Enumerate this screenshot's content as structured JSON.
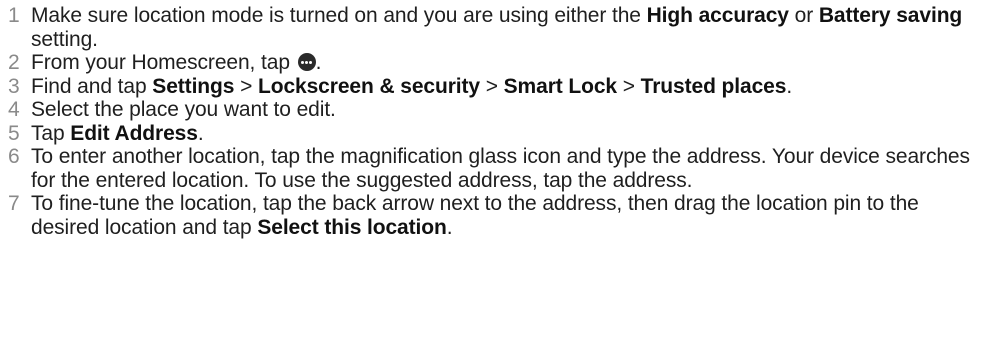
{
  "steps": [
    {
      "number": "1",
      "parts": [
        {
          "text": "Make sure location mode is turned on and you are using either the "
        },
        {
          "text": "High accuracy",
          "bold": true
        },
        {
          "text": " or "
        },
        {
          "text": "Battery saving",
          "bold": true
        },
        {
          "text": " setting."
        }
      ]
    },
    {
      "number": "2",
      "parts": [
        {
          "text": "From your Homescreen, tap "
        },
        {
          "icon": "apps-icon"
        },
        {
          "text": "."
        }
      ]
    },
    {
      "number": "3",
      "parts": [
        {
          "text": "Find and tap "
        },
        {
          "text": "Settings",
          "bold": true
        },
        {
          "text": " > "
        },
        {
          "text": "Lockscreen & security",
          "bold": true
        },
        {
          "text": " > "
        },
        {
          "text": "Smart Lock",
          "bold": true
        },
        {
          "text": " > "
        },
        {
          "text": "Trusted places",
          "bold": true
        },
        {
          "text": "."
        }
      ]
    },
    {
      "number": "4",
      "parts": [
        {
          "text": "Select the place you want to edit."
        }
      ]
    },
    {
      "number": "5",
      "parts": [
        {
          "text": "Tap "
        },
        {
          "text": "Edit Address",
          "bold": true
        },
        {
          "text": "."
        }
      ]
    },
    {
      "number": "6",
      "parts": [
        {
          "text": "To enter another location, tap the magnification glass icon and type the address. Your device searches for the entered location. To use the suggested address, tap the address."
        }
      ]
    },
    {
      "number": "7",
      "parts": [
        {
          "text": "To fine-tune the location, tap the back arrow next to the address, then drag the location pin to the desired location and tap "
        },
        {
          "text": "Select this location",
          "bold": true
        },
        {
          "text": "."
        }
      ]
    }
  ]
}
